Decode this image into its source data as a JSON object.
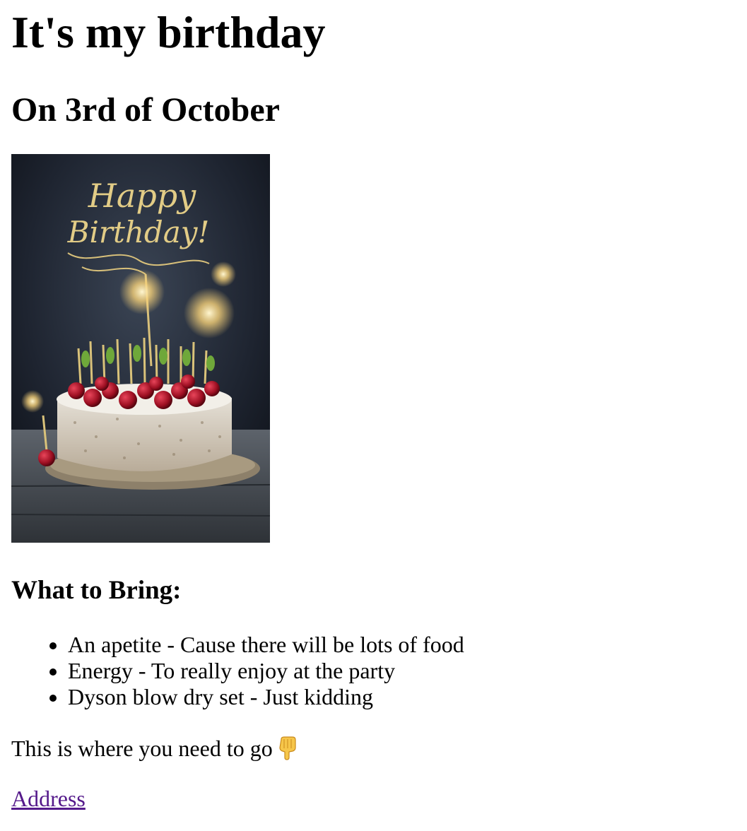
{
  "page": {
    "title": "It's my birthday",
    "date_heading": "On 3rd of October",
    "image": {
      "topper_text_line1": "Happy",
      "topper_text_line2": "Birthday!"
    },
    "bring_heading": "What to Bring:",
    "bring_items": [
      "An apetite - Cause there will be lots of food",
      "Energy - To really enjoy at the party",
      "Dyson blow dry set - Just kidding"
    ],
    "directions_text": "This is where you need to go",
    "directions_icon": "pointing-down-hand-icon",
    "address_link": "Address"
  },
  "colors": {
    "text": "#000000",
    "link_visited": "#551a8b",
    "background": "#ffffff"
  }
}
